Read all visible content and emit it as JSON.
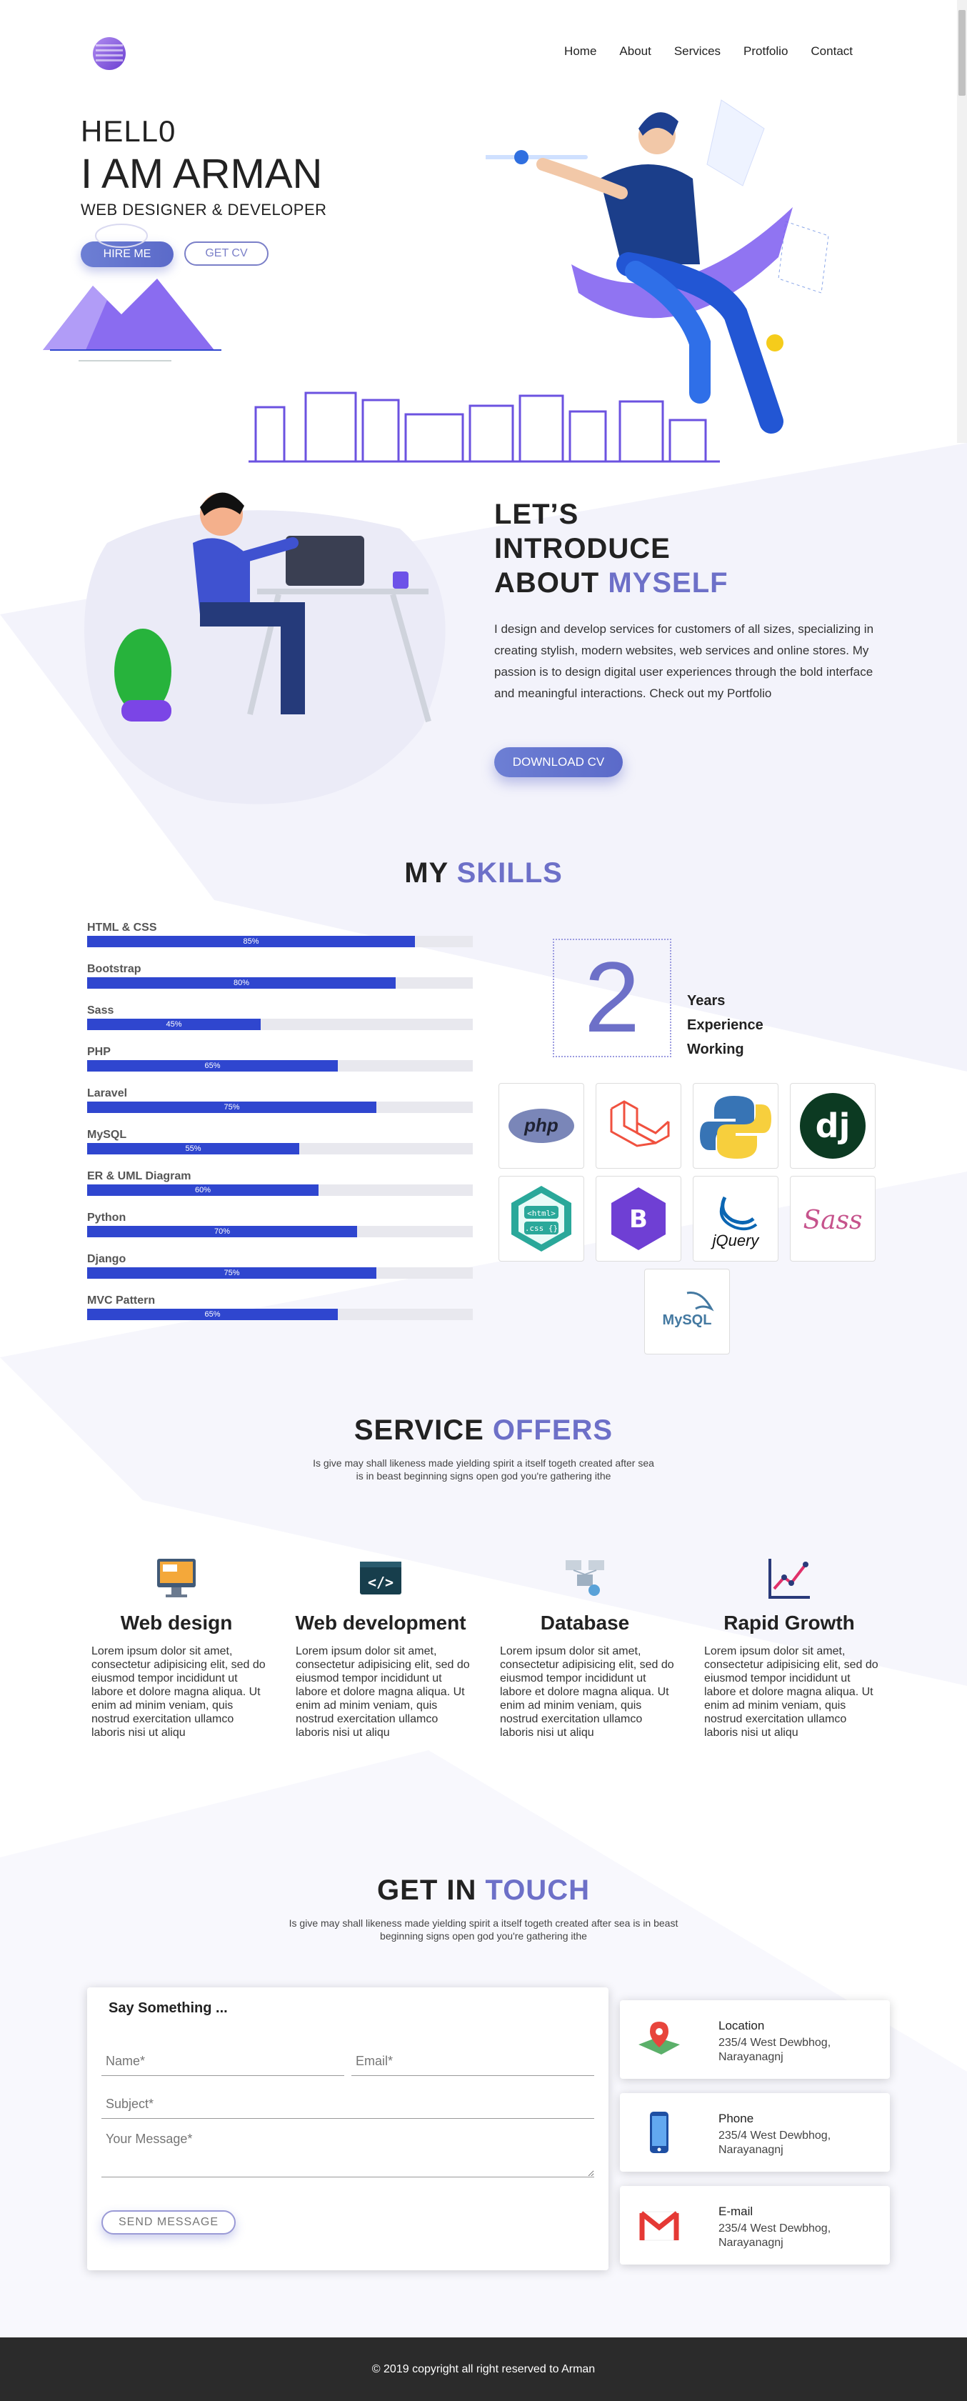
{
  "nav": {
    "logo_icon": "logo-icon",
    "items": [
      "Home",
      "About",
      "Services",
      "Protfolio",
      "Contact"
    ]
  },
  "hero": {
    "hello": "HELL0",
    "name": "I AM ARMAN",
    "role": "WEB DESIGNER & DEVELOPER",
    "hire_button": "HIRE ME",
    "cv_button": "GET CV"
  },
  "about": {
    "title_line1": "LET’S",
    "title_line2": "INTRODUCE",
    "title_line3_a": "ABOUT ",
    "title_line3_b": "MYSELF",
    "description": "I design and develop services for customers of all sizes, specializing in creating stylish, modern websites, web services and online stores. My passion is to design digital user experiences through the bold interface and meaningful interactions. Check out my Portfolio",
    "download_button": "DOWNLOAD CV"
  },
  "skills": {
    "title_a": "MY ",
    "title_b": "SKILLS",
    "items": [
      {
        "name": "HTML & CSS",
        "percent": 85,
        "label": "85%"
      },
      {
        "name": "Bootstrap",
        "percent": 80,
        "label": "80%"
      },
      {
        "name": "Sass",
        "percent": 45,
        "label": "45%"
      },
      {
        "name": "PHP",
        "percent": 65,
        "label": "65%"
      },
      {
        "name": "Laravel",
        "percent": 75,
        "label": "75%"
      },
      {
        "name": "MySQL",
        "percent": 55,
        "label": "55%"
      },
      {
        "name": "ER & UML Diagram",
        "percent": 60,
        "label": "60%"
      },
      {
        "name": "Python",
        "percent": 70,
        "label": "70%"
      },
      {
        "name": "Django",
        "percent": 75,
        "label": "75%"
      },
      {
        "name": "MVC Pattern",
        "percent": 65,
        "label": "65%"
      }
    ],
    "experience_number": "2",
    "experience_l1": "Years",
    "experience_l2": "Experience",
    "experience_l3": "Working",
    "logos": {
      "php": "php",
      "html_css_top": "<html>",
      "html_css_bottom": ".css {}",
      "jquery": "jQuery",
      "sass": "Sass",
      "mysql": "MySQL"
    },
    "logo_icons": [
      "php-icon",
      "laravel-icon",
      "python-icon",
      "django-icon",
      "html-css-icon",
      "bootstrap-icon",
      "jquery-icon",
      "sass-icon",
      "mysql-icon"
    ]
  },
  "services": {
    "title_a": "SERVICE ",
    "title_b": "OFFERS",
    "subtitle_l1": "Is give may shall likeness made yielding spirit a itself togeth created after sea",
    "subtitle_l2": "is in beast beginning signs open god you're gathering ithe",
    "items": [
      {
        "title": "Web design",
        "icon": "web-design-icon",
        "desc": "Lorem ipsum dolor sit amet, consectetur adipisicing elit, sed do eiusmod tempor incididunt ut labore et dolore magna aliqua. Ut enim ad minim veniam, quis nostrud exercitation ullamco laboris nisi ut aliqu"
      },
      {
        "title": "Web development",
        "icon": "code-icon",
        "desc": "Lorem ipsum dolor sit amet, consectetur adipisicing elit, sed do eiusmod tempor incididunt ut labore et dolore magna aliqua. Ut enim ad minim veniam, quis nostrud exercitation ullamco laboris nisi ut aliqu"
      },
      {
        "title": "Database",
        "icon": "database-icon",
        "desc": "Lorem ipsum dolor sit amet, consectetur adipisicing elit, sed do eiusmod tempor incididunt ut labore et dolore magna aliqua. Ut enim ad minim veniam, quis nostrud exercitation ullamco laboris nisi ut aliqu"
      },
      {
        "title": "Rapid Growth",
        "icon": "growth-chart-icon",
        "desc": "Lorem ipsum dolor sit amet, consectetur adipisicing elit, sed do eiusmod tempor incididunt ut labore et dolore magna aliqua. Ut enim ad minim veniam, quis nostrud exercitation ullamco laboris nisi ut aliqu"
      }
    ]
  },
  "contact": {
    "title_a": "GET IN ",
    "title_b": "TOUCH",
    "subtitle_l1": "Is give may shall likeness made yielding spirit a itself togeth created after sea is in beast",
    "subtitle_l2": "beginning signs open god you're gathering ithe",
    "form": {
      "title": "Say Something ...",
      "name_placeholder": "Name*",
      "email_placeholder": "Email*",
      "subject_placeholder": "Subject*",
      "message_placeholder": "Your Message*",
      "send_button": "SEND MESSAGE"
    },
    "info": [
      {
        "title": "Location",
        "text": "235/4 West Dewbhog, Narayanagnj",
        "icon": "map-pin-icon"
      },
      {
        "title": "Phone",
        "text": "235/4 West Dewbhog, Narayanagnj",
        "icon": "phone-icon"
      },
      {
        "title": "E-mail",
        "text": "235/4 West Dewbhog, Narayanagnj",
        "icon": "gmail-icon"
      }
    ]
  },
  "footer": {
    "copyright": "© 2019 copyright all right reserved to Arman"
  },
  "colors": {
    "accent": "#6d70c8",
    "skill_bar": "#2f46cf",
    "footer_bg": "#2b2b2b"
  }
}
